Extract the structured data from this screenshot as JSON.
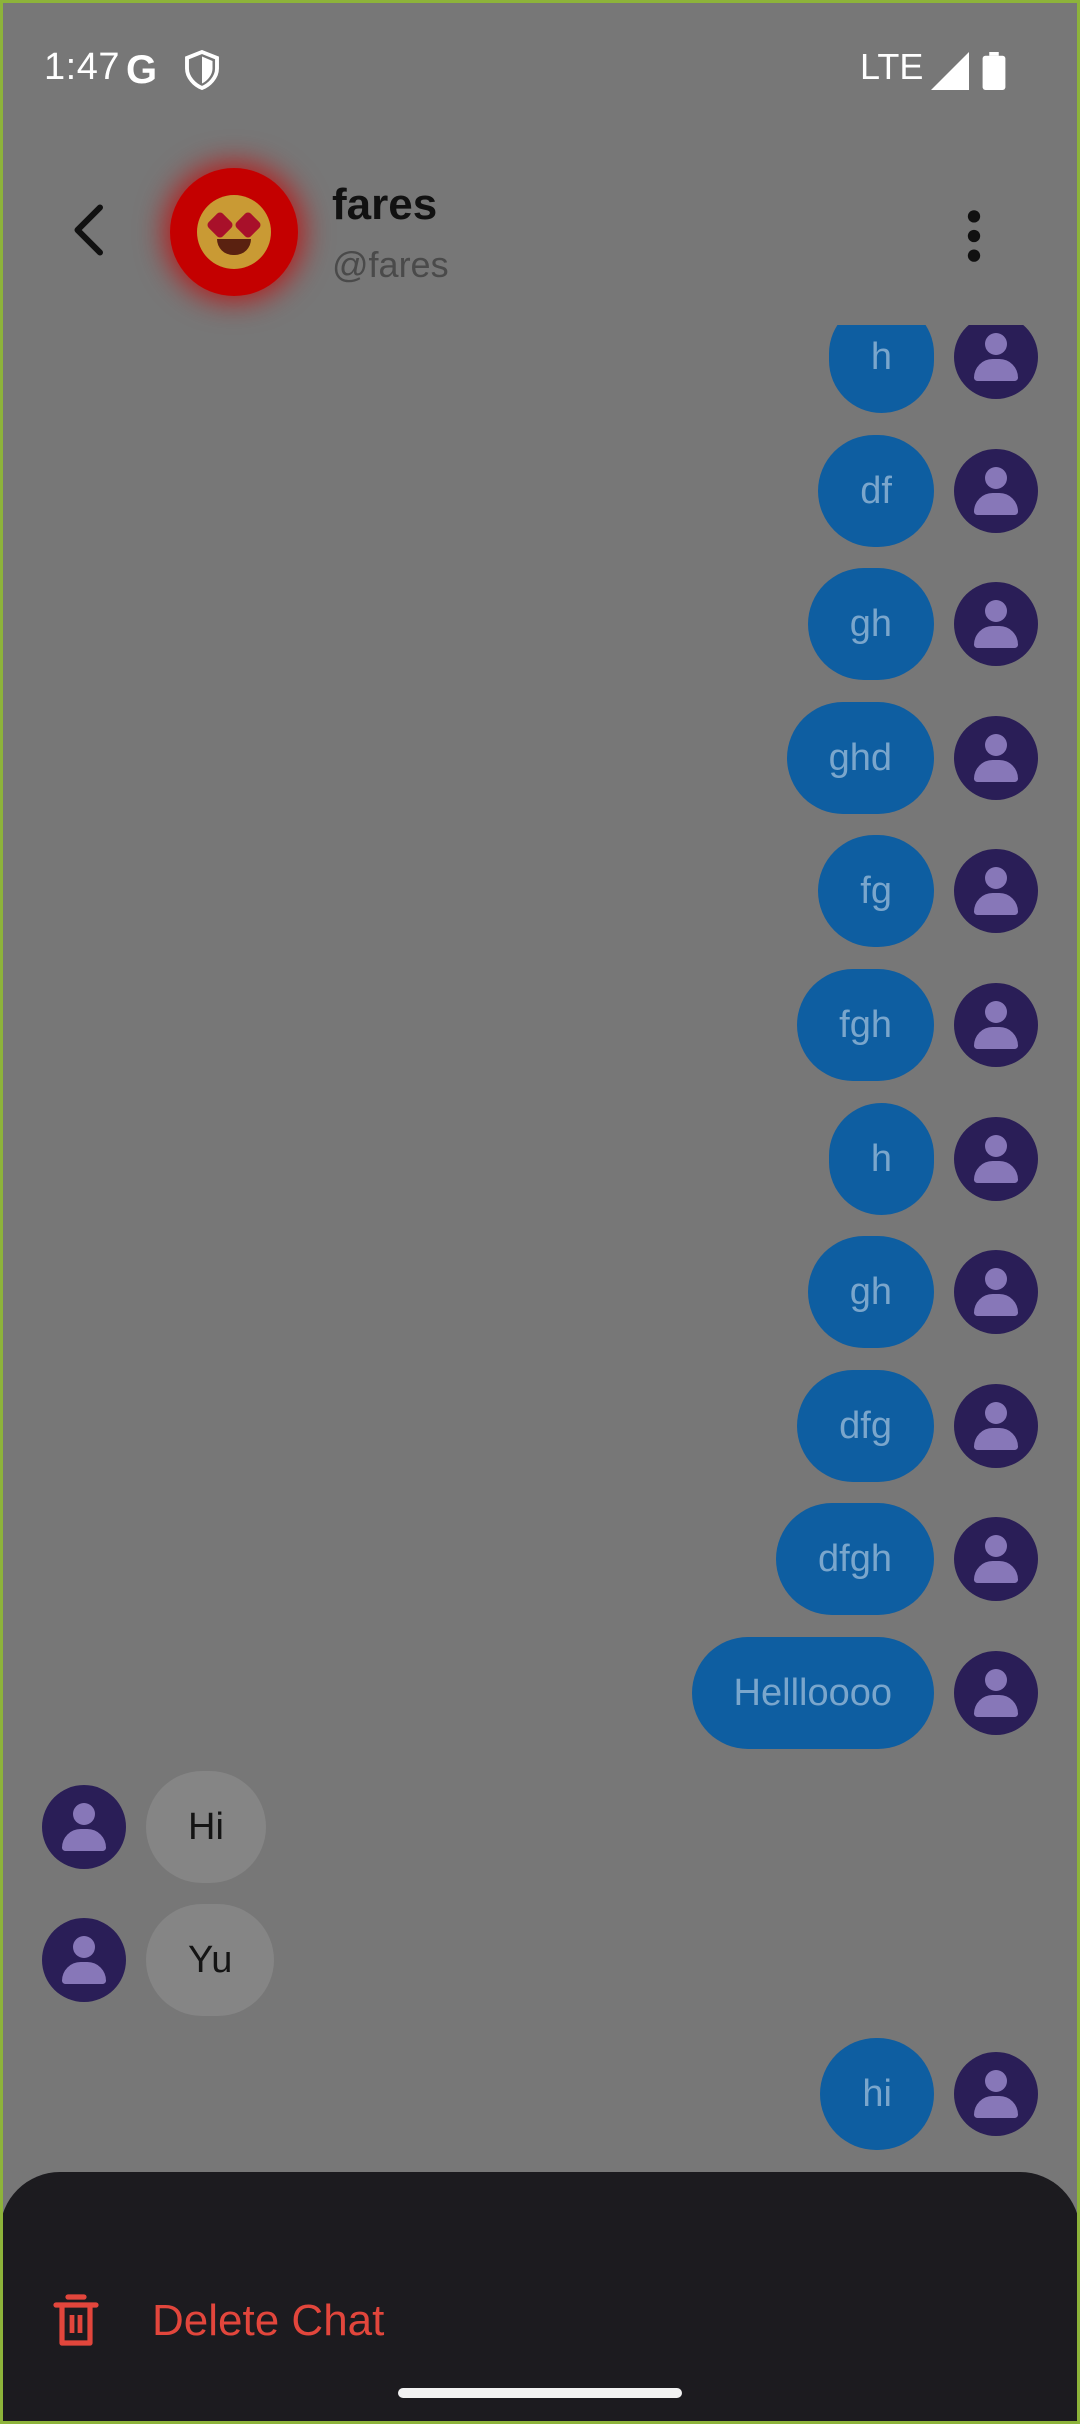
{
  "status_bar": {
    "time": "1:47",
    "google_glyph": "G",
    "network": "LTE"
  },
  "header": {
    "name": "fares",
    "handle": "@fares"
  },
  "messages": [
    {
      "text": "h",
      "dir": "out"
    },
    {
      "text": "df",
      "dir": "out"
    },
    {
      "text": "gh",
      "dir": "out"
    },
    {
      "text": "ghd",
      "dir": "out"
    },
    {
      "text": "fg",
      "dir": "out"
    },
    {
      "text": "fgh",
      "dir": "out"
    },
    {
      "text": "h",
      "dir": "out"
    },
    {
      "text": "gh",
      "dir": "out"
    },
    {
      "text": "dfg",
      "dir": "out"
    },
    {
      "text": "dfgh",
      "dir": "out"
    },
    {
      "text": "Hellloooo",
      "dir": "out"
    },
    {
      "text": "Hi",
      "dir": "in"
    },
    {
      "text": "Yu",
      "dir": "in"
    },
    {
      "text": "hi",
      "dir": "out"
    }
  ],
  "sheet": {
    "delete_label": "Delete Chat"
  },
  "colors": {
    "outgoing_bubble": "#0e5ea1",
    "incoming_bubble": "#858585",
    "danger": "#e2463c",
    "sheet_bg": "#1c1b1f"
  }
}
